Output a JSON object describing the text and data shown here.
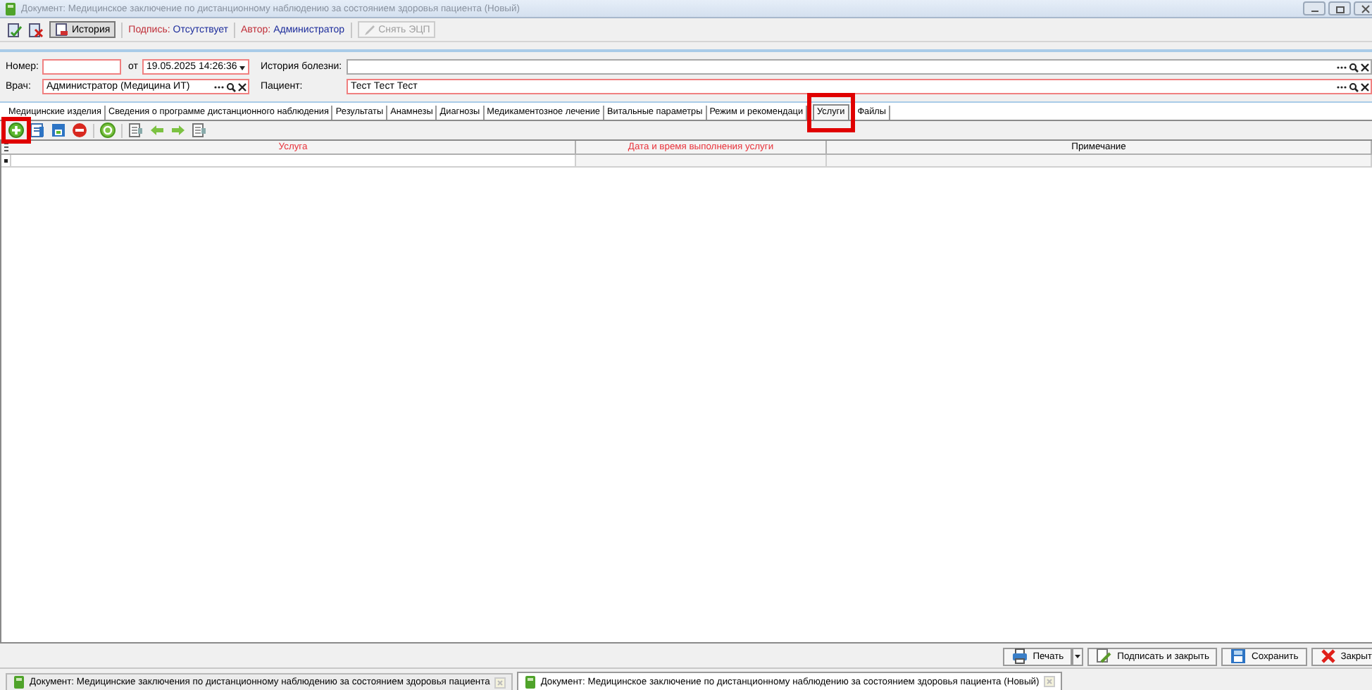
{
  "window": {
    "title": "Документ: Медицинское заключение по дистанционному наблюдению за состоянием здоровья пациента (Новый)",
    "active": false
  },
  "toolbar": {
    "history_button": {
      "label": "История",
      "pressed": true
    },
    "signature": {
      "label": "Подпись:",
      "value": "Отсутствует"
    },
    "author": {
      "label": "Автор:",
      "value": "Администратор"
    },
    "remove_signature_button": {
      "label": "Снять ЭЦП",
      "disabled": true
    }
  },
  "form": {
    "fields": [
      {
        "kind": "text",
        "label": "Номер:",
        "required": true
      },
      {
        "kind": "date",
        "label": "от",
        "value": "19.05.2025 14:26:36",
        "required": true
      },
      {
        "kind": "lookup",
        "label": "История болезни:",
        "required": false
      },
      {
        "kind": "lookup",
        "label": "Врач:",
        "value": "Администратор (Медицина ИТ)",
        "required": true
      },
      {
        "kind": "lookup",
        "label": "Пациент:",
        "value": "Тест Тест Тест",
        "required": true
      }
    ]
  },
  "tabs": [
    {
      "label": "Медицинские изделия",
      "selected": false,
      "highlighted": false
    },
    {
      "label": "Сведения о программе дистанционного наблюдения",
      "selected": false,
      "highlighted": false
    },
    {
      "label": "Результаты",
      "selected": false,
      "highlighted": false
    },
    {
      "label": "Анамнезы",
      "selected": false,
      "highlighted": false
    },
    {
      "label": "Диагнозы",
      "selected": false,
      "highlighted": false
    },
    {
      "label": "Медикаментозное лечение",
      "selected": false,
      "highlighted": false
    },
    {
      "label": "Витальные параметры",
      "selected": false,
      "highlighted": false
    },
    {
      "label": "Режим и рекомендаци",
      "selected": false,
      "highlighted": false
    },
    {
      "label": "Услуги",
      "selected": true,
      "highlighted": true
    },
    {
      "label": "Файлы",
      "selected": false,
      "highlighted": false
    }
  ],
  "grid_toolbar": [
    {
      "kind": "add",
      "highlighted": true
    },
    {
      "kind": "edit",
      "highlighted": false
    },
    {
      "kind": "save",
      "highlighted": false
    },
    {
      "kind": "delete",
      "highlighted": false
    },
    {
      "kind": "refresh",
      "highlighted": false
    },
    {
      "kind": "document",
      "highlighted": false
    },
    {
      "kind": "left",
      "highlighted": false
    },
    {
      "kind": "right",
      "highlighted": false
    },
    {
      "kind": "document",
      "highlighted": false
    }
  ],
  "grid": {
    "columns": [
      {
        "label": "Услуга",
        "required": true
      },
      {
        "label": "Дата и время выполнения услуги",
        "required": true
      },
      {
        "label": "Примечание",
        "required": false
      }
    ]
  },
  "footer_buttons": [
    {
      "kind": "print",
      "label": "Печать",
      "dropdown": true
    },
    {
      "kind": "sign",
      "label": "Подписать и закрыть",
      "dropdown": false
    },
    {
      "kind": "save",
      "label": "Сохранить",
      "dropdown": false
    },
    {
      "kind": "close",
      "label": "Закрыт",
      "dropdown": false
    }
  ],
  "taskbar": [
    {
      "label": "Документ: Медицинские заключения по дистанционному наблюдению за состоянием здоровья пациента",
      "selected": false
    },
    {
      "label": "Документ: Медицинское заключение по дистанционному наблюдению за состоянием здоровья пациента (Новый)",
      "selected": true
    }
  ]
}
